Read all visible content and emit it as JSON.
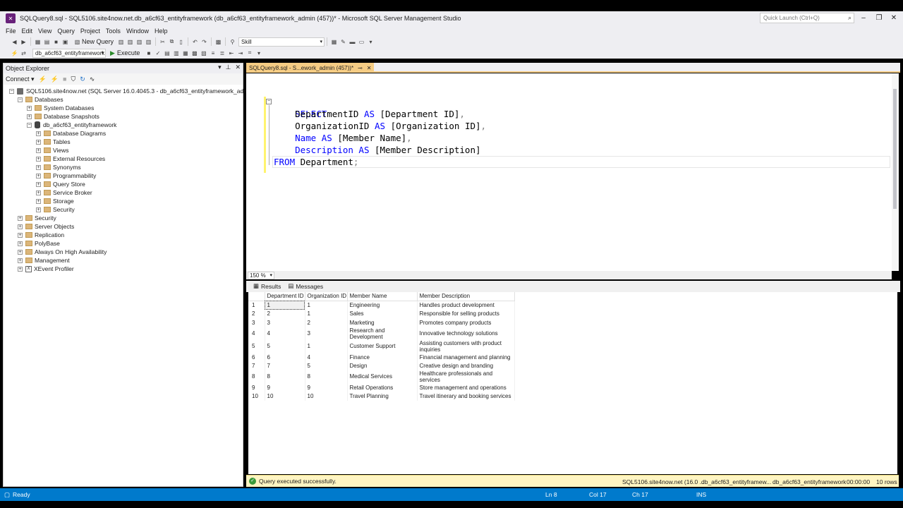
{
  "window": {
    "title": "SQLQuery8.sql - SQL5106.site4now.net.db_a6cf63_entityframework (db_a6cf63_entityframework_admin (457))* - Microsoft SQL Server Management Studio",
    "quick_launch_placeholder": "Quick Launch (Ctrl+Q)"
  },
  "menu": [
    "File",
    "Edit",
    "View",
    "Query",
    "Project",
    "Tools",
    "Window",
    "Help"
  ],
  "toolbar": {
    "new_query_label": "New Query",
    "config_value": "Skill",
    "database_value": "db_a6cf63_entityframework",
    "execute_label": "Execute"
  },
  "object_explorer": {
    "title": "Object Explorer",
    "connect_label": "Connect",
    "tree": [
      {
        "label": "SQL5106.site4now.net (SQL Server 16.0.4045.3 - db_a6cf63_entityframework_admin)",
        "level": 0,
        "icon": "server-icon",
        "expander": "−"
      },
      {
        "label": "Databases",
        "level": 1,
        "icon": "folder-icon",
        "expander": "−"
      },
      {
        "label": "System Databases",
        "level": 2,
        "icon": "folder-icon",
        "expander": "+"
      },
      {
        "label": "Database Snapshots",
        "level": 2,
        "icon": "folder-icon",
        "expander": "+"
      },
      {
        "label": "db_a6cf63_entityframework",
        "level": 2,
        "icon": "database-icon",
        "expander": "−"
      },
      {
        "label": "Database Diagrams",
        "level": 3,
        "icon": "folder-icon",
        "expander": "+"
      },
      {
        "label": "Tables",
        "level": 3,
        "icon": "folder-icon",
        "expander": "+"
      },
      {
        "label": "Views",
        "level": 3,
        "icon": "folder-icon",
        "expander": "+"
      },
      {
        "label": "External Resources",
        "level": 3,
        "icon": "folder-icon",
        "expander": "+"
      },
      {
        "label": "Synonyms",
        "level": 3,
        "icon": "folder-icon",
        "expander": "+"
      },
      {
        "label": "Programmability",
        "level": 3,
        "icon": "folder-icon",
        "expander": "+"
      },
      {
        "label": "Query Store",
        "level": 3,
        "icon": "folder-icon",
        "expander": "+"
      },
      {
        "label": "Service Broker",
        "level": 3,
        "icon": "folder-icon",
        "expander": "+"
      },
      {
        "label": "Storage",
        "level": 3,
        "icon": "folder-icon",
        "expander": "+"
      },
      {
        "label": "Security",
        "level": 3,
        "icon": "folder-icon",
        "expander": "+"
      },
      {
        "label": "Security",
        "level": 1,
        "icon": "folder-icon",
        "expander": "+"
      },
      {
        "label": "Server Objects",
        "level": 1,
        "icon": "folder-icon",
        "expander": "+"
      },
      {
        "label": "Replication",
        "level": 1,
        "icon": "folder-icon",
        "expander": "+"
      },
      {
        "label": "PolyBase",
        "level": 1,
        "icon": "folder-icon",
        "expander": "+"
      },
      {
        "label": "Always On High Availability",
        "level": 1,
        "icon": "folder-icon",
        "expander": "+"
      },
      {
        "label": "Management",
        "level": 1,
        "icon": "folder-icon",
        "expander": "+"
      },
      {
        "label": "XEvent Profiler",
        "level": 1,
        "icon": "xevent-icon",
        "expander": "+"
      }
    ]
  },
  "editor": {
    "tab_label": "SQLQuery8.sql - S...ework_admin (457))*",
    "zoom": "150 %",
    "code": {
      "l1_kw": "SELECT",
      "l2_a": "    DepartmentID ",
      "l2_kw": "AS",
      "l2_b": " [Department ID]",
      "l2_c": ",",
      "l3_a": "    OrganizationID ",
      "l3_kw": "AS",
      "l3_b": " [Organization ID]",
      "l3_c": ",",
      "l4_kw1": "    Name",
      "l4_kw2": " AS",
      "l4_b": " [Member Name]",
      "l4_c": ",",
      "l5_kw1": "    Description",
      "l5_kw2": " AS",
      "l5_b": " [Member Description]",
      "l6_kw": "FROM",
      "l6_b": " Department",
      "l6_c": ";"
    }
  },
  "results": {
    "tab_results": "Results",
    "tab_messages": "Messages",
    "columns": [
      "Department ID",
      "Organization ID",
      "Member Name",
      "Member Description"
    ],
    "rows": [
      [
        "1",
        "1",
        "1",
        "Engineering",
        "Handles product development"
      ],
      [
        "2",
        "2",
        "1",
        "Sales",
        "Responsible for selling products"
      ],
      [
        "3",
        "3",
        "2",
        "Marketing",
        "Promotes company products"
      ],
      [
        "4",
        "4",
        "3",
        "Research and Development",
        "Innovative technology solutions"
      ],
      [
        "5",
        "5",
        "1",
        "Customer Support",
        "Assisting customers with product inquiries"
      ],
      [
        "6",
        "6",
        "4",
        "Finance",
        "Financial management and planning"
      ],
      [
        "7",
        "7",
        "5",
        "Design",
        "Creative design and branding"
      ],
      [
        "8",
        "8",
        "8",
        "Medical Services",
        "Healthcare professionals and services"
      ],
      [
        "9",
        "9",
        "9",
        "Retail Operations",
        "Store management and operations"
      ],
      [
        "10",
        "10",
        "10",
        "Travel Planning",
        "Travel itinerary and booking services"
      ]
    ]
  },
  "query_status": {
    "message": "Query executed successfully.",
    "server": "SQL5106.site4now.net (16.0 ...",
    "user": "db_a6cf63_entityframew...",
    "database": "db_a6cf63_entityframework",
    "elapsed": "00:00:00",
    "row_count": "10 rows"
  },
  "statusbar": {
    "state": "Ready",
    "ln": "Ln 8",
    "col": "Col 17",
    "ch": "Ch 17",
    "mode": "INS"
  }
}
